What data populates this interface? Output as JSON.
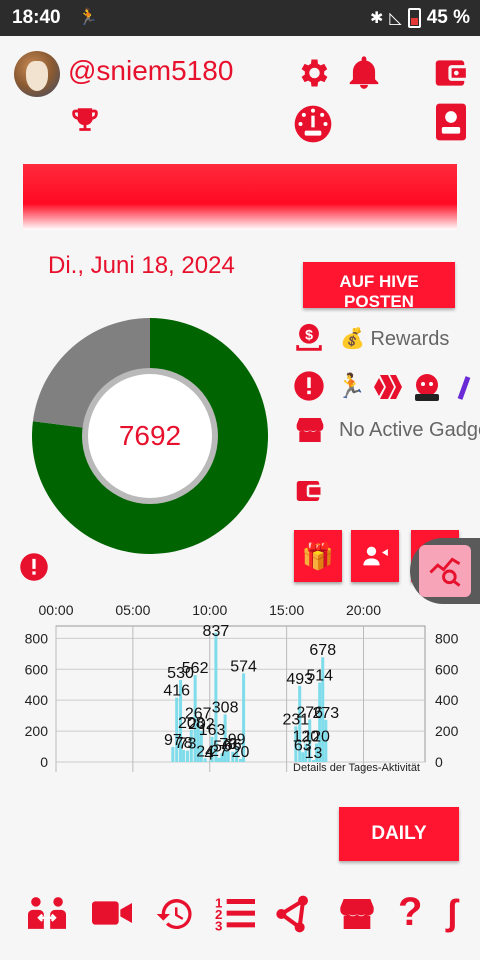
{
  "status_bar": {
    "time": "18:40",
    "battery": "45 %",
    "icons": [
      "activity-icon",
      "bluetooth-icon",
      "signal-icon",
      "battery-icon"
    ]
  },
  "header": {
    "username": "@sniem5180",
    "icons": [
      "gear-icon",
      "bell-icon",
      "wallet-icon",
      "trophy-icon",
      "gauge-icon",
      "id-card-icon"
    ]
  },
  "main": {
    "date": "Di., Juni 18, 2024",
    "hive_button": "AUF HIVE POSTEN",
    "reward_text": "💰 Rewards",
    "gadgets_text": "No Active Gadgets",
    "score": "7692"
  },
  "donut": {
    "values": [
      0.77,
      0.23
    ],
    "colors": [
      "#006400",
      "#808080"
    ]
  },
  "chart_data": {
    "type": "bar",
    "x_ticks": [
      "00:00",
      "05:00",
      "10:00",
      "15:00",
      "20:00"
    ],
    "y_ticks": [
      "0",
      "200",
      "400",
      "600",
      "800"
    ],
    "ylim": [
      0,
      880
    ],
    "xlim": [
      0,
      24
    ],
    "description_label": "Details der Tages-Aktivität",
    "bars": [
      {
        "h": 7.6,
        "v": 97
      },
      {
        "h": 7.85,
        "v": 416
      },
      {
        "h": 8.1,
        "v": 530
      },
      {
        "h": 8.3,
        "v": 78
      },
      {
        "h": 8.55,
        "v": 73
      },
      {
        "h": 8.8,
        "v": 208
      },
      {
        "h": 9.05,
        "v": 562
      },
      {
        "h": 9.25,
        "v": 267
      },
      {
        "h": 9.45,
        "v": 202
      },
      {
        "h": 9.7,
        "v": 24
      },
      {
        "h": 9.95,
        "v": 4
      },
      {
        "h": 10.15,
        "v": 163
      },
      {
        "h": 10.4,
        "v": 837
      },
      {
        "h": 10.6,
        "v": 27
      },
      {
        "h": 10.8,
        "v": 56
      },
      {
        "h": 11.0,
        "v": 308
      },
      {
        "h": 11.2,
        "v": 70
      },
      {
        "h": 11.5,
        "v": 66
      },
      {
        "h": 11.75,
        "v": 99
      },
      {
        "h": 12.0,
        "v": 20
      },
      {
        "h": 12.2,
        "v": 574
      },
      {
        "h": 15.6,
        "v": 231
      },
      {
        "h": 15.85,
        "v": 493
      },
      {
        "h": 16.05,
        "v": 63
      },
      {
        "h": 16.25,
        "v": 120
      },
      {
        "h": 16.5,
        "v": 276
      },
      {
        "h": 16.75,
        "v": 13
      },
      {
        "h": 16.95,
        "v": 120
      },
      {
        "h": 17.15,
        "v": 514
      },
      {
        "h": 17.35,
        "v": 678
      },
      {
        "h": 17.55,
        "v": 273
      }
    ]
  },
  "daily_button": "DAILY",
  "bottom_nav": [
    "activity-link-icon",
    "video-icon",
    "history-icon",
    "leaderboard-icon",
    "share-icon",
    "store-icon",
    "help-icon",
    "more-icon"
  ]
}
